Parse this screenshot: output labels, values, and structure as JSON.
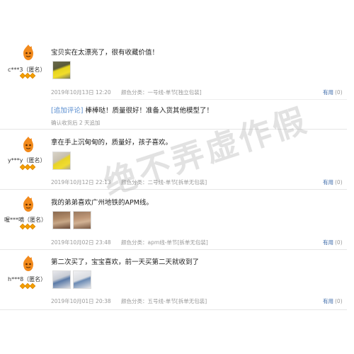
{
  "watermark_text": "绝不弄虚作假",
  "reviews": [
    {
      "username": "c***3（匿名）",
      "comment": "宝贝实在太漂亮了，很有收藏价值！",
      "date": "2019年10月13日 12:20",
      "category": "颜色分类：一号线-单节[独立包装]",
      "helpful_label": "有用",
      "helpful_count": "(0)",
      "followup_label": "[追加评论]",
      "followup_text": "棒棒哒！质量很好！准备入货其他模型了！",
      "followup_time": "确认收货后 2 天追加"
    },
    {
      "username": "y***y（匿名）",
      "comment": "拿在手上沉甸甸的，质量好，孩子喜欢。",
      "date": "2019年10月12日 22:13",
      "category": "颜色分类：二号线-单节[拆单无包装]",
      "helpful_label": "有用",
      "helpful_count": "(0)"
    },
    {
      "username": "喔***嘀（匿名）",
      "comment": "我的弟弟喜欢广州地铁的APM线。",
      "date": "2019年10月02日 23:48",
      "category": "颜色分类：apm线-单节[拆单无包装]",
      "helpful_label": "有用",
      "helpful_count": "(0)"
    },
    {
      "username": "h***8（匿名）",
      "comment": "第二次买了，宝宝喜欢，前一天买第二天就收到了",
      "date": "2019年10月01日 20:38",
      "category": "颜色分类：五号线-单节[拆单无包装]",
      "helpful_label": "有用",
      "helpful_count": "(0)"
    }
  ],
  "colors": {
    "accent_link": "#3a68a8",
    "followup_label": "#5a8ed0",
    "medal": "#f4a000",
    "avatar_orange": "#f28a1c"
  }
}
